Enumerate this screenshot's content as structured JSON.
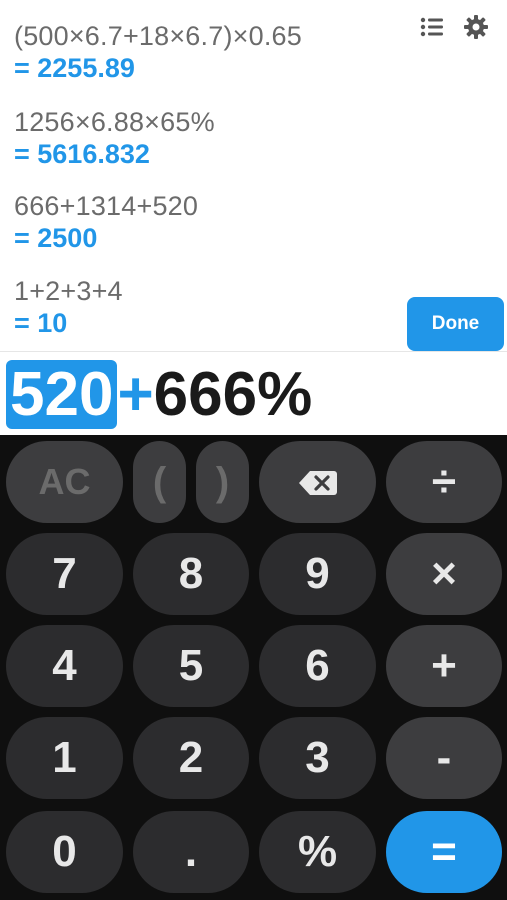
{
  "history": [
    {
      "expr": "(500×6.7+18×6.7)×0.65",
      "result": "= 2255.89"
    },
    {
      "expr": "1256×6.88×65%",
      "result": "= 5616.832"
    },
    {
      "expr": "666+1314+520",
      "result": "= 2500"
    },
    {
      "expr": "1+2+3+4",
      "result": "= 10"
    }
  ],
  "toolbar": {
    "history_icon": "list-icon",
    "settings_icon": "gear-icon"
  },
  "done_label": "Done",
  "input": {
    "selected": "520",
    "operator": "+",
    "rest": "666%"
  },
  "keys": {
    "ac": "AC",
    "open_paren": "(",
    "close_paren": ")",
    "backspace_icon": "backspace-icon",
    "divide": "÷",
    "seven": "7",
    "eight": "8",
    "nine": "9",
    "multiply": "×",
    "four": "4",
    "five": "5",
    "six": "6",
    "plus": "+",
    "one": "1",
    "two": "2",
    "three": "3",
    "minus": "-",
    "zero": "0",
    "dot": ".",
    "percent": "%",
    "equals": "="
  },
  "colors": {
    "accent": "#2196e8",
    "keypad_bg": "#0f0f0f",
    "key_num": "#2c2c2e",
    "key_func": "#3d3d3f"
  }
}
